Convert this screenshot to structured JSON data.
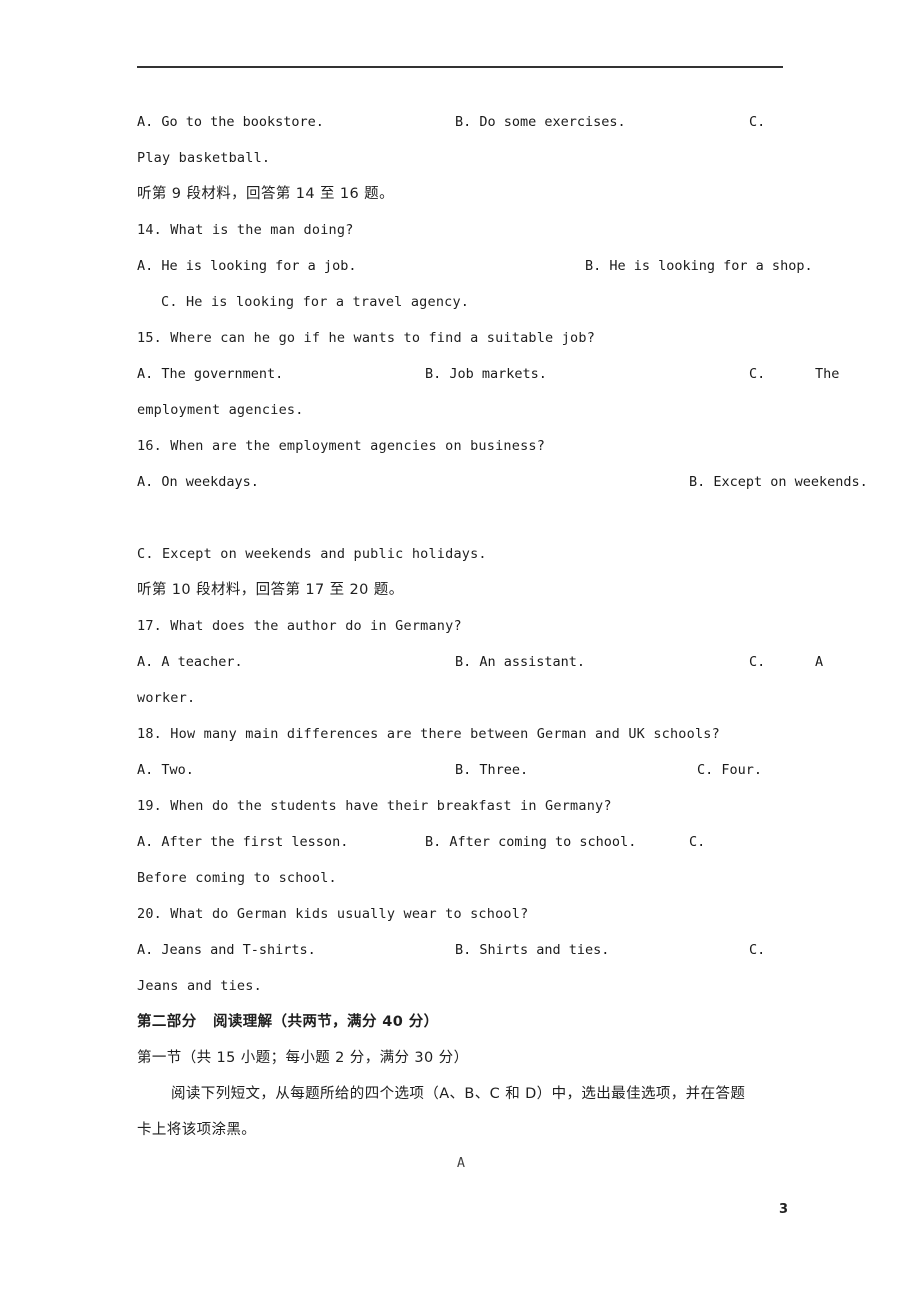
{
  "document": {
    "page_number": "3",
    "section_marker": "A"
  },
  "q13": {
    "option_a": "A. Go to the bookstore.",
    "option_b": "B. Do some exercises.",
    "option_c_prefix": "C.",
    "option_c_wrap": "Play basketball."
  },
  "listen_9": "听第 9 段材料，回答第 14 至 16 题。",
  "q14": {
    "stem": "14. What is the man doing?",
    "option_a": "A. He is looking for a job.",
    "option_b": "B. He is looking for a shop.",
    "option_c": "C. He is looking for a travel agency."
  },
  "q15": {
    "stem": "15. Where can he go if he wants to find a suitable job?",
    "option_a": "A. The government.",
    "option_b": "B. Job markets.",
    "option_c_prefix": "C.",
    "option_c_tail": "The",
    "option_c_wrap": "employment agencies."
  },
  "q16": {
    "stem": "16. When are the employment agencies on business?",
    "option_a": "A. On weekdays.",
    "option_b": "B. Except on weekends.",
    "option_c": "C. Except on weekends and public holidays."
  },
  "listen_10": "听第 10 段材料，回答第 17 至 20 题。",
  "q17": {
    "stem": "17. What does the author do in Germany?",
    "option_a": "A. A teacher.",
    "option_b": "B. An assistant.",
    "option_c_prefix": "C.",
    "option_c_tail": "A",
    "option_c_wrap": "worker."
  },
  "q18": {
    "stem": "18. How many main differences are there between German and UK schools?",
    "option_a": "A. Two.",
    "option_b": "B. Three.",
    "option_c": "C. Four."
  },
  "q19": {
    "stem": "19. When do the students have their breakfast in Germany?",
    "option_a": "A. After the first lesson.",
    "option_b": "B. After coming to school.",
    "option_c_prefix": "C.",
    "option_c_wrap": "Before coming to school."
  },
  "q20": {
    "stem": "20. What do German kids usually wear to school?",
    "option_a": "A. Jeans and T-shirts.",
    "option_b": "B. Shirts and ties.",
    "option_c_prefix": "C.",
    "option_c_wrap": "Jeans and ties."
  },
  "part_two": {
    "heading": "第二部分   阅读理解（共两节，满分 40 分）",
    "subheading": "第一节（共 15 小题；每小题 2 分，满分 30 分）",
    "instruction_line1": "阅读下列短文，从每题所给的四个选项（A、B、C 和 D）中，选出最佳选项，并在答题",
    "instruction_line2": "卡上将该项涂黑。"
  }
}
